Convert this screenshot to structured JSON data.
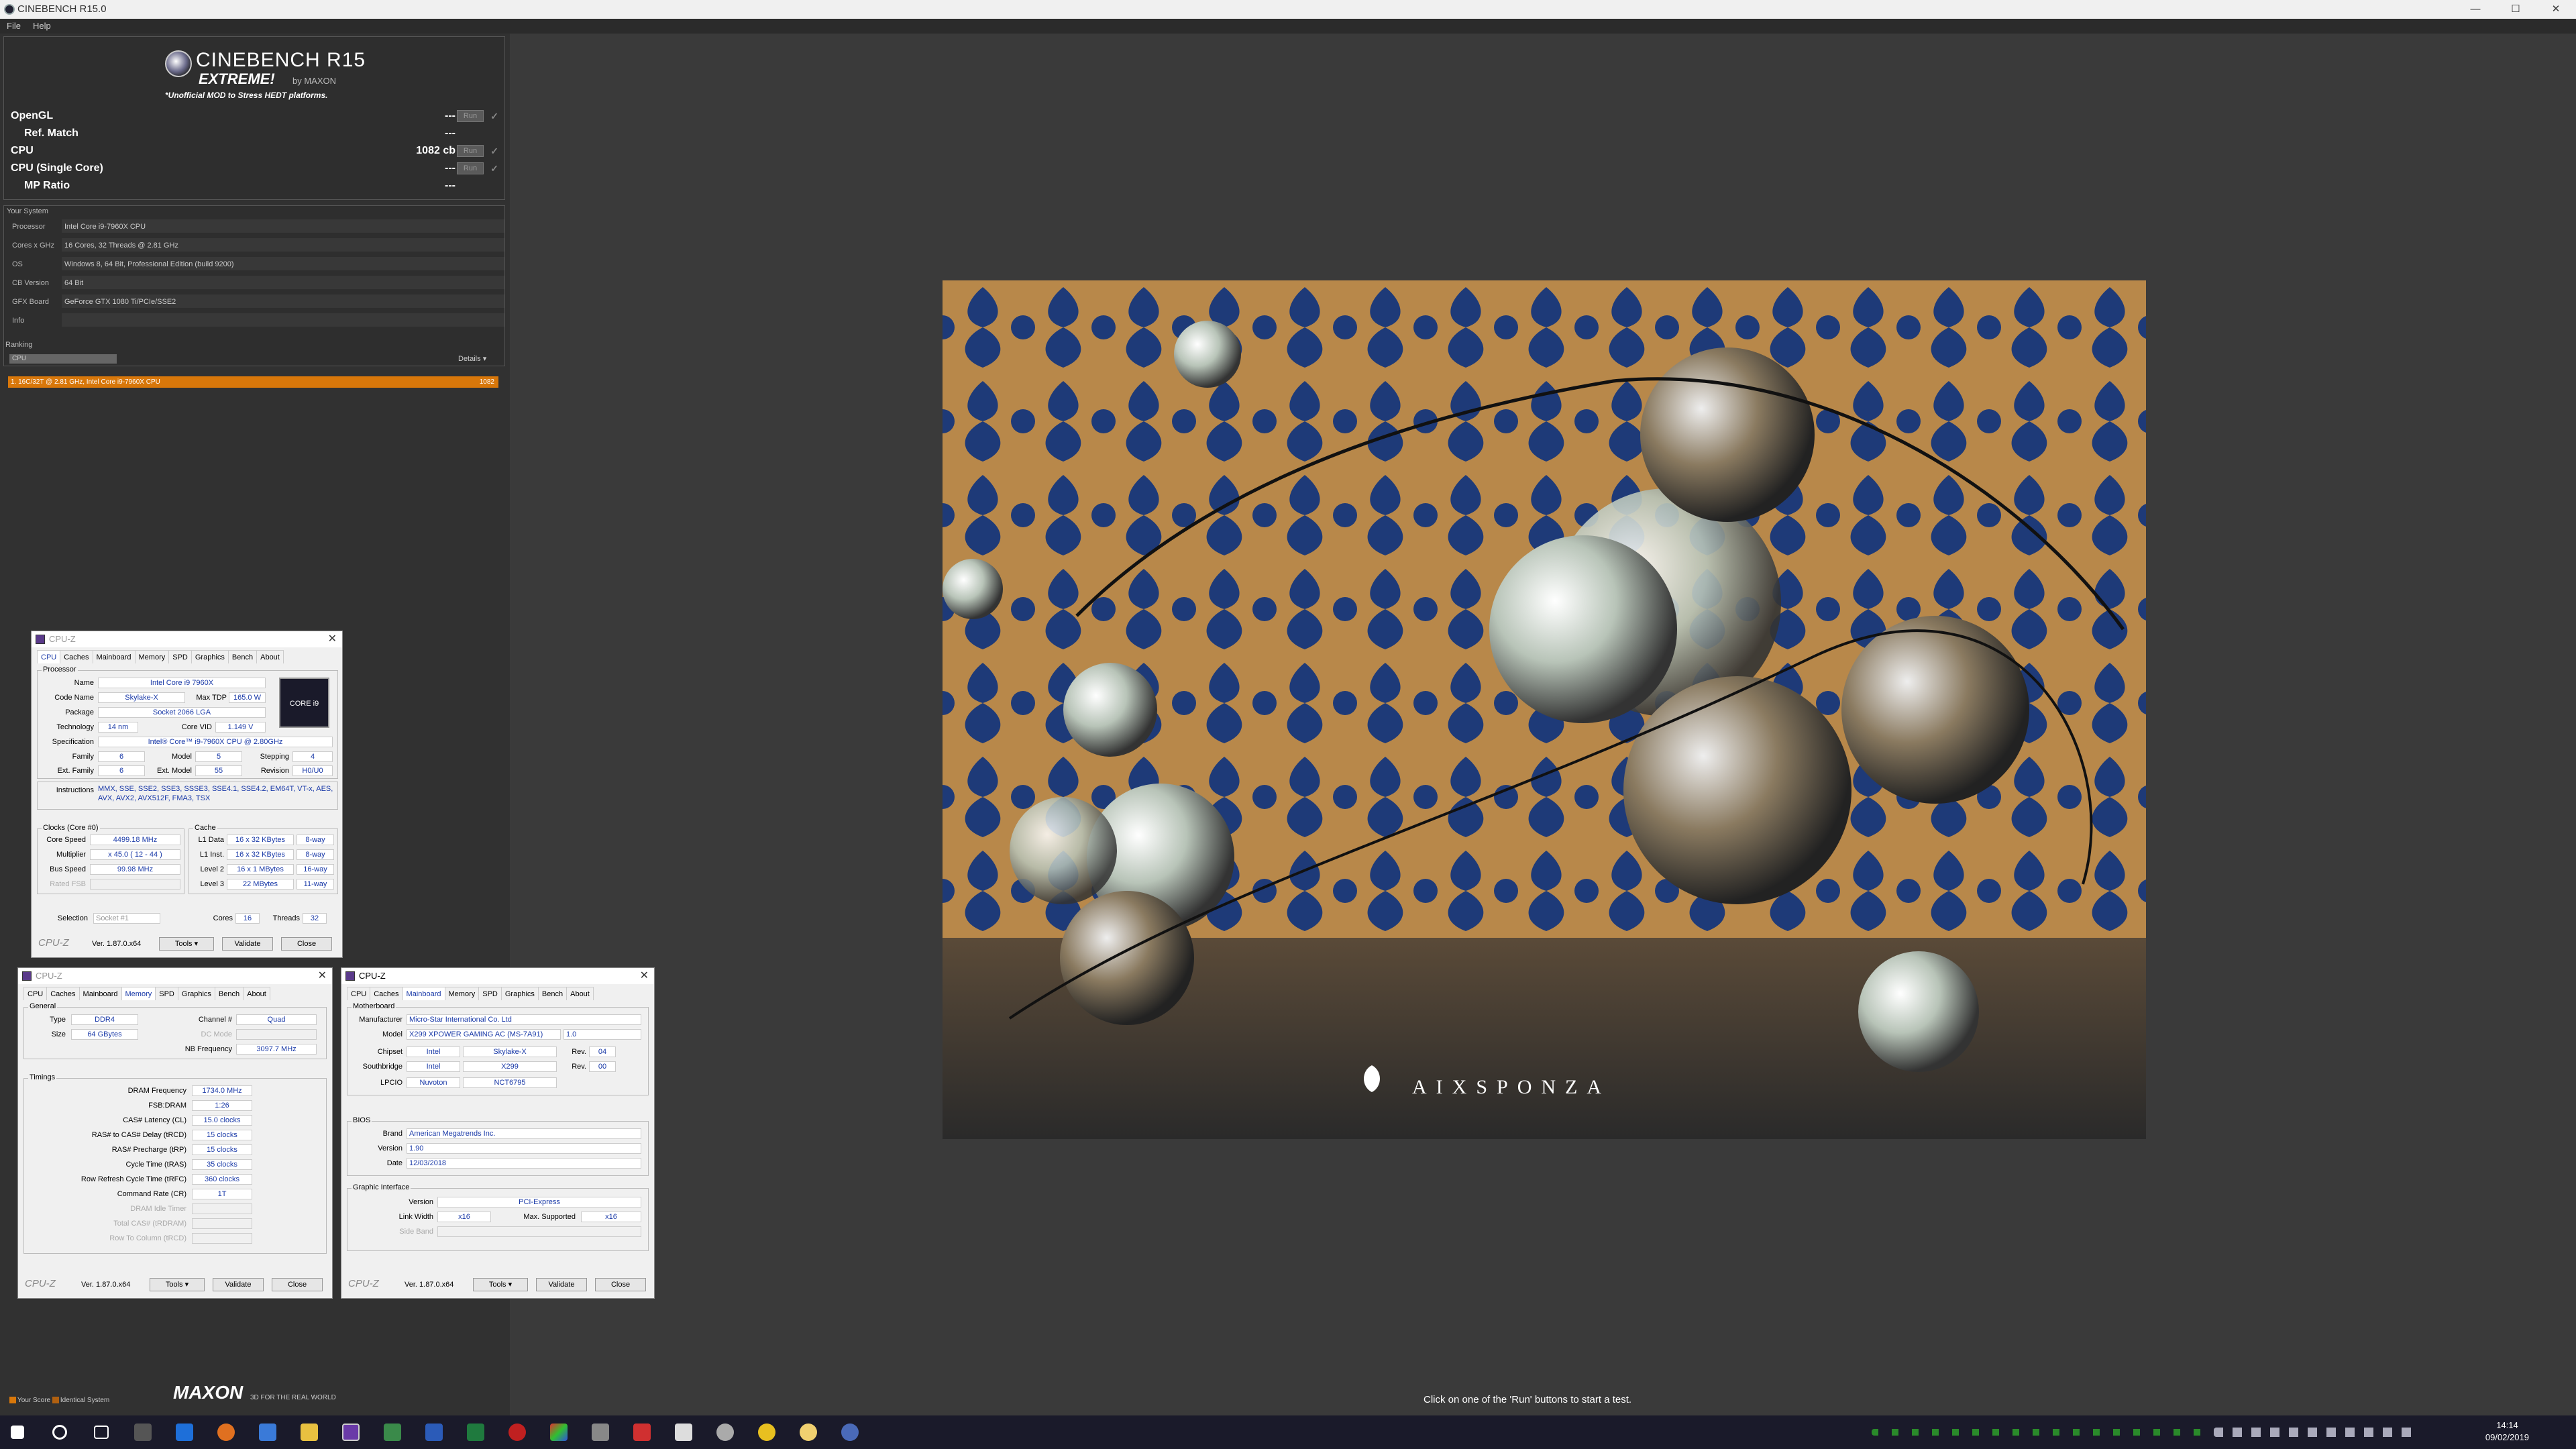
{
  "window": {
    "title": "CINEBENCH R15.0"
  },
  "menu": [
    "File",
    "Help"
  ],
  "logo": {
    "name": "CINEBENCH R15",
    "edition": "EXTREME!",
    "by": "by MAXON",
    "mod": "*Unofficial MOD to Stress HEDT platforms."
  },
  "tests": [
    {
      "label": "OpenGL",
      "value": "---",
      "run": "Run"
    },
    {
      "label": "Ref. Match",
      "value": "---"
    },
    {
      "label": "CPU",
      "value": "1082 cb",
      "run": "Run"
    },
    {
      "label": "CPU (Single Core)",
      "value": "---",
      "run": "Run"
    },
    {
      "label": "MP Ratio",
      "value": "---"
    }
  ],
  "system": {
    "title": "Your System",
    "rows": [
      {
        "k": "Processor",
        "v": "Intel Core i9-7960X CPU"
      },
      {
        "k": "Cores x GHz",
        "v": "16 Cores, 32 Threads @ 2.81 GHz"
      },
      {
        "k": "OS",
        "v": "Windows 8, 64 Bit, Professional Edition (build 9200)"
      },
      {
        "k": "CB Version",
        "v": "64 Bit"
      },
      {
        "k": "GFX Board",
        "v": "GeForce GTX 1080 Ti/PCIe/SSE2"
      },
      {
        "k": "Info",
        "v": ""
      }
    ]
  },
  "ranking": {
    "title": "Ranking",
    "select": "CPU",
    "details": "Details",
    "entry": "1. 16C/32T @ 2.81 GHz, Intel Core i9-7960X CPU",
    "score": "1082"
  },
  "legend": {
    "your": "Your Score",
    "identical": "Identical System"
  },
  "footer": {
    "brand": "MAXON",
    "tag": "3D FOR THE REAL WORLD",
    "status": "Click on one of the 'Run' buttons to start a test."
  },
  "render": {
    "watermark": "AIXSPONZA"
  },
  "cpuz_cpu": {
    "title": "CPU-Z",
    "tabs": [
      "CPU",
      "Caches",
      "Mainboard",
      "Memory",
      "SPD",
      "Graphics",
      "Bench",
      "About"
    ],
    "processor": "Processor",
    "name_l": "Name",
    "name": "Intel Core i9 7960X",
    "code_l": "Code Name",
    "code": "Skylake-X",
    "tdp_l": "Max TDP",
    "tdp": "165.0 W",
    "pkg_l": "Package",
    "pkg": "Socket 2066 LGA",
    "tech_l": "Technology",
    "tech": "14 nm",
    "vid_l": "Core VID",
    "vid": "1.149 V",
    "spec_l": "Specification",
    "spec": "Intel® Core™ i9-7960X CPU @ 2.80GHz",
    "fam_l": "Family",
    "fam": "6",
    "model_l": "Model",
    "model": "5",
    "step_l": "Stepping",
    "step": "4",
    "efam_l": "Ext. Family",
    "efam": "6",
    "emod_l": "Ext. Model",
    "emod": "55",
    "rev_l": "Revision",
    "rev": "H0/U0",
    "instr_l": "Instructions",
    "instr": "MMX, SSE, SSE2, SSE3, SSSE3, SSE4.1, SSE4.2, EM64T, VT-x, AES, AVX, AVX2, AVX512F, FMA3, TSX",
    "clocks": "Clocks (Core #0)",
    "cs_l": "Core Speed",
    "cs": "4499.18 MHz",
    "mul_l": "Multiplier",
    "mul": "x 45.0 ( 12 - 44 )",
    "bus_l": "Bus Speed",
    "bus": "99.98 MHz",
    "fsb_l": "Rated FSB",
    "cache": "Cache",
    "l1d_l": "L1 Data",
    "l1d": "16 x 32 KBytes",
    "l1d_w": "8-way",
    "l1i_l": "L1 Inst.",
    "l1i": "16 x 32 KBytes",
    "l1i_w": "8-way",
    "l2_l": "Level 2",
    "l2": "16 x 1 MBytes",
    "l2_w": "16-way",
    "l3_l": "Level 3",
    "l3": "22 MBytes",
    "l3_w": "11-way",
    "sel_l": "Selection",
    "sel": "Socket #1",
    "cores_l": "Cores",
    "cores": "16",
    "thr_l": "Threads",
    "thr": "32",
    "logo": "CPU-Z",
    "ver": "Ver. 1.87.0.x64",
    "tools": "Tools",
    "validate": "Validate",
    "close": "Close",
    "intel_badge": "CORE i9"
  },
  "cpuz_mem": {
    "title": "CPU-Z",
    "general": "General",
    "type_l": "Type",
    "type": "DDR4",
    "size_l": "Size",
    "size": "64 GBytes",
    "ch_l": "Channel #",
    "ch": "Quad",
    "dc_l": "DC Mode",
    "nb_l": "NB Frequency",
    "nb": "3097.7 MHz",
    "timings": "Timings",
    "rows": [
      {
        "k": "DRAM Frequency",
        "v": "1734.0 MHz"
      },
      {
        "k": "FSB:DRAM",
        "v": "1:26"
      },
      {
        "k": "CAS# Latency (CL)",
        "v": "15.0 clocks"
      },
      {
        "k": "RAS# to CAS# Delay (tRCD)",
        "v": "15 clocks"
      },
      {
        "k": "RAS# Precharge (tRP)",
        "v": "15 clocks"
      },
      {
        "k": "Cycle Time (tRAS)",
        "v": "35 clocks"
      },
      {
        "k": "Row Refresh Cycle Time (tRFC)",
        "v": "360 clocks"
      },
      {
        "k": "Command Rate (CR)",
        "v": "1T"
      },
      {
        "k": "DRAM Idle Timer",
        "v": ""
      },
      {
        "k": "Total CAS# (tRDRAM)",
        "v": ""
      },
      {
        "k": "Row To Column (tRCD)",
        "v": ""
      }
    ]
  },
  "cpuz_mb": {
    "title": "CPU-Z",
    "motherboard": "Motherboard",
    "man_l": "Manufacturer",
    "man": "Micro-Star International Co. Ltd",
    "model_l": "Model",
    "model": "X299 XPOWER GAMING AC (MS-7A91)",
    "model_rev": "1.0",
    "chip_l": "Chipset",
    "chip_v": "Intel",
    "chip_n": "Skylake-X",
    "chip_rl": "Rev.",
    "chip_r": "04",
    "sb_l": "Southbridge",
    "sb_v": "Intel",
    "sb_n": "X299",
    "sb_rl": "Rev.",
    "sb_r": "00",
    "lpc_l": "LPCIO",
    "lpc_v": "Nuvoton",
    "lpc_n": "NCT6795",
    "bios": "BIOS",
    "brand_l": "Brand",
    "brand": "American Megatrends Inc.",
    "bver_l": "Version",
    "bver": "1.90",
    "date_l": "Date",
    "date": "12/03/2018",
    "gi": "Graphic Interface",
    "gv_l": "Version",
    "gv": "PCI-Express",
    "lw_l": "Link Width",
    "lw": "x16",
    "ms_l": "Max. Supported",
    "ms": "x16",
    "sb2_l": "Side Band"
  },
  "clock": {
    "time": "14:14",
    "date": "09/02/2019"
  }
}
